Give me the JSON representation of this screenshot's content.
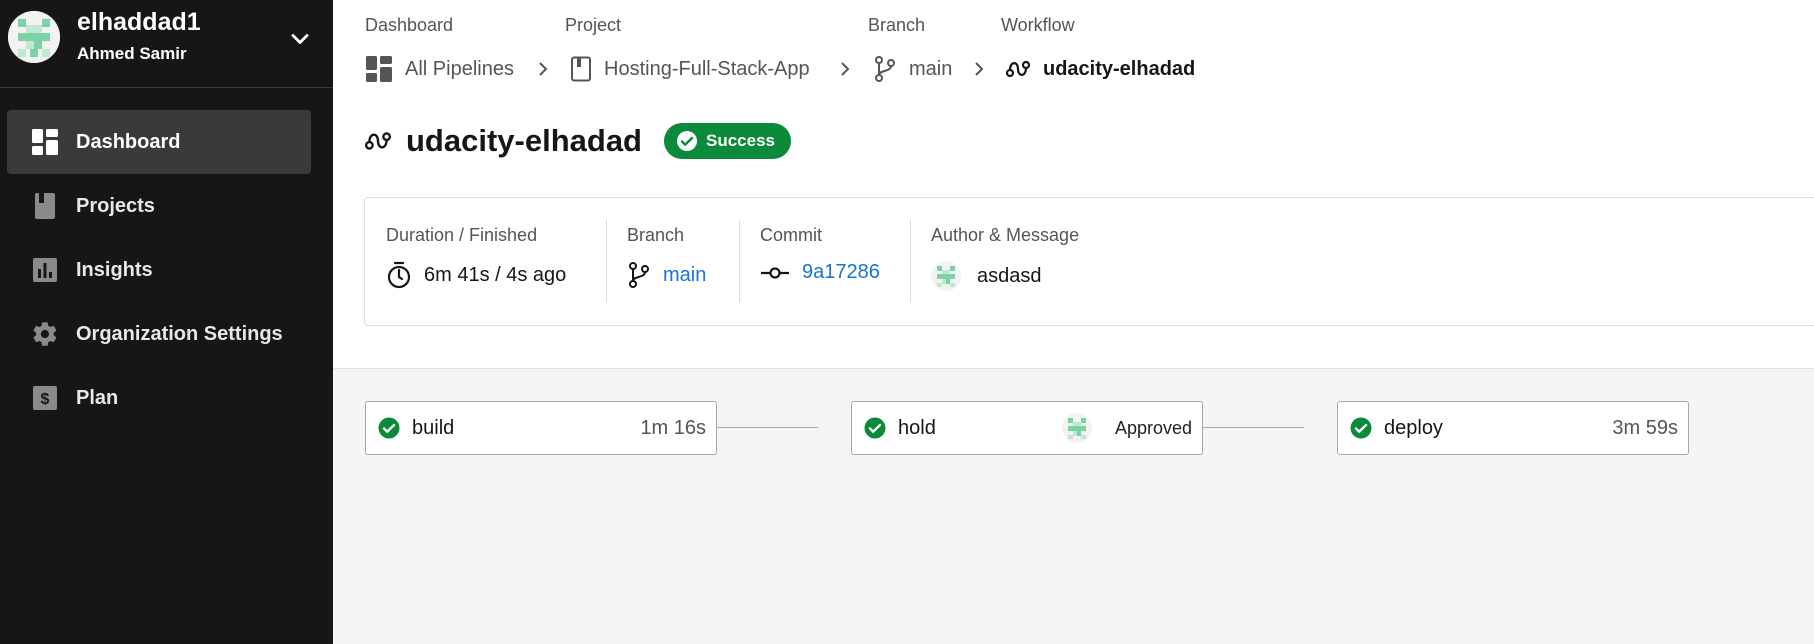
{
  "colors": {
    "success": "#0a8a3a",
    "link": "#1a73d3",
    "sidebar": "#161616",
    "avatar_green": "#7bd2a4"
  },
  "org": {
    "name": "elhaddad1",
    "user": "Ahmed Samir"
  },
  "nav": {
    "items": [
      {
        "label": "Dashboard",
        "icon": "dashboard-icon",
        "active": true
      },
      {
        "label": "Projects",
        "icon": "projects-icon"
      },
      {
        "label": "Insights",
        "icon": "insights-icon"
      },
      {
        "label": "Organization Settings",
        "icon": "gear-icon"
      },
      {
        "label": "Plan",
        "icon": "plan-icon"
      }
    ]
  },
  "breadcrumb": {
    "labels": [
      "Dashboard",
      "Project",
      "Branch",
      "Workflow"
    ],
    "items": [
      "All Pipelines",
      "Hosting-Full-Stack-App",
      "main",
      "udacity-elhadad"
    ]
  },
  "workflow": {
    "title": "udacity-elhadad",
    "status": "Success"
  },
  "info": {
    "duration_label": "Duration / Finished",
    "duration_value": "6m 41s / 4s ago",
    "branch_label": "Branch",
    "branch_value": "main",
    "commit_label": "Commit",
    "commit_value": "9a17286",
    "author_label": "Author & Message",
    "author_message": "asdasd"
  },
  "jobs": [
    {
      "name": "build",
      "duration": "1m 16s",
      "status": "success"
    },
    {
      "name": "hold",
      "approval": "Approved",
      "status": "success"
    },
    {
      "name": "deploy",
      "duration": "3m 59s",
      "status": "success"
    }
  ]
}
